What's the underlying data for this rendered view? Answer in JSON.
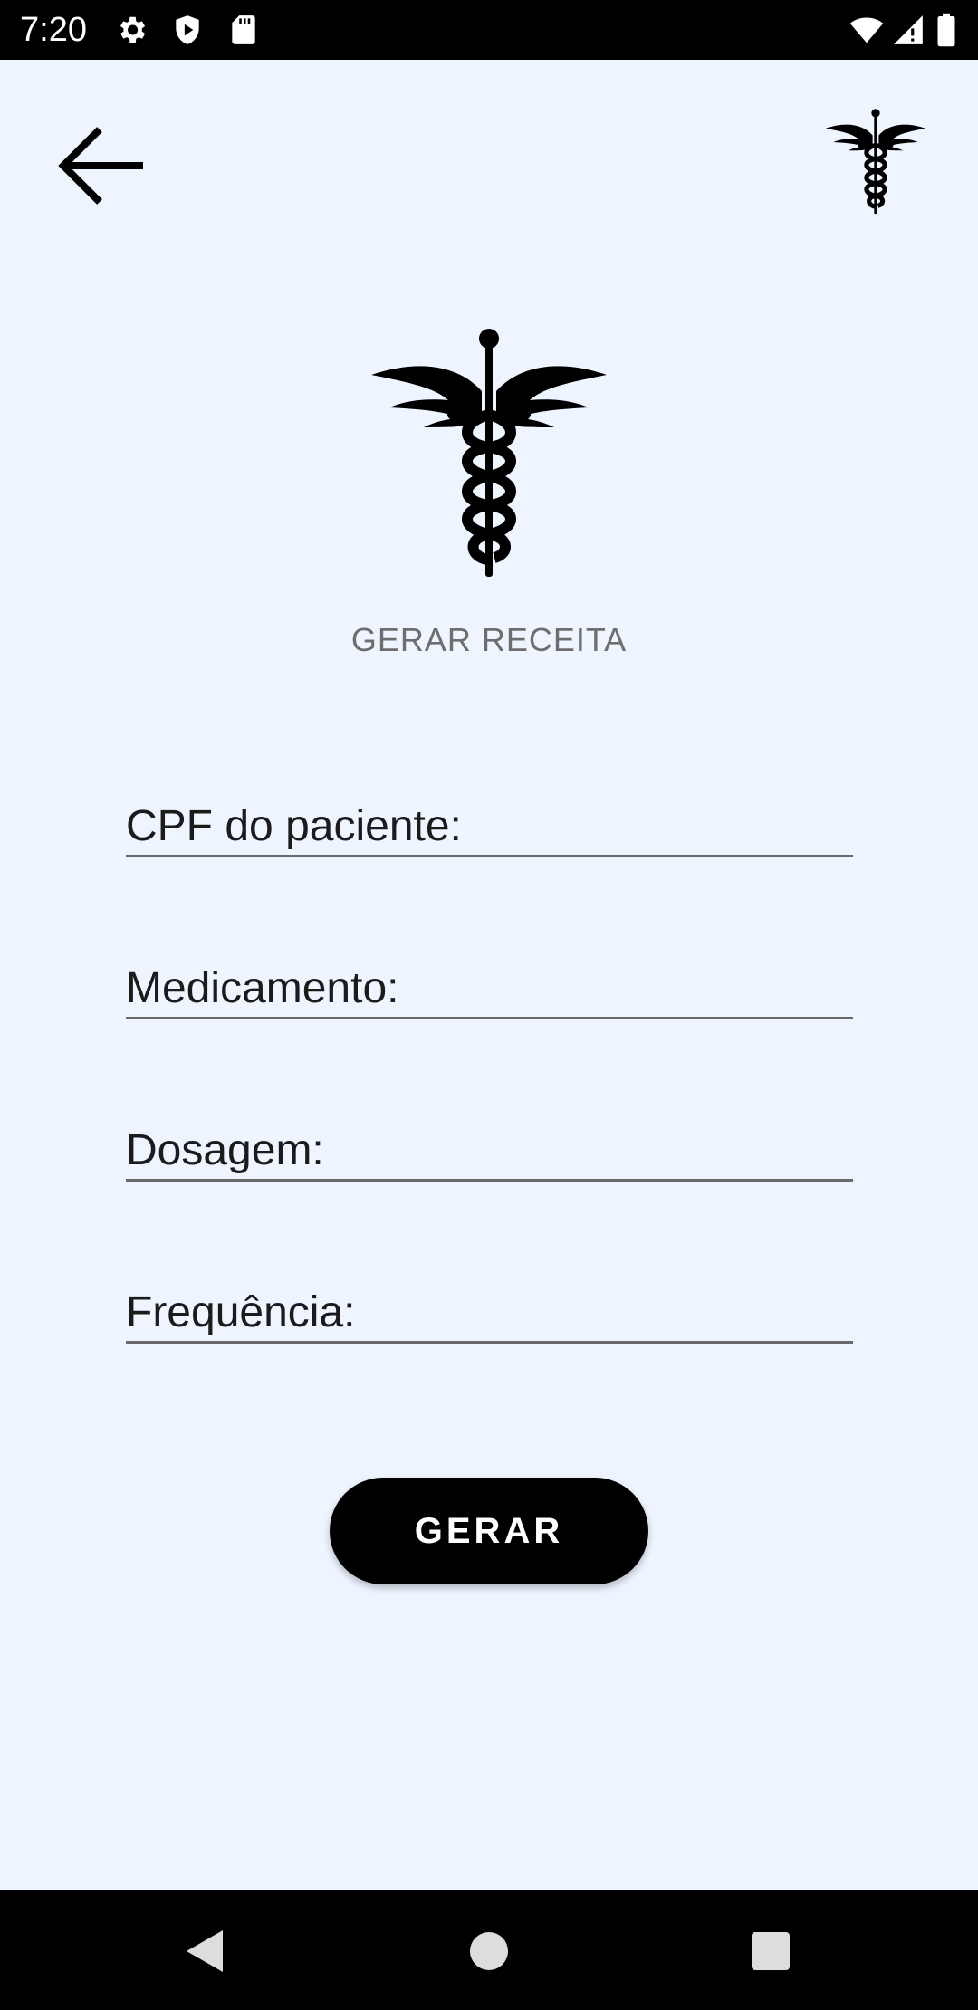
{
  "status_bar": {
    "time": "7:20",
    "icons": [
      "settings-icon",
      "shield-icon",
      "sd-card-icon",
      "wifi-icon",
      "signal-icon",
      "battery-icon"
    ]
  },
  "header": {
    "back_icon": "arrow-left-icon",
    "logo_icon": "caduceus-icon"
  },
  "main": {
    "logo_icon": "caduceus-icon",
    "title": "GERAR RECEITA",
    "fields": [
      {
        "placeholder": "CPF do paciente:",
        "value": ""
      },
      {
        "placeholder": "Medicamento:",
        "value": ""
      },
      {
        "placeholder": "Dosagem:",
        "value": ""
      },
      {
        "placeholder": "Frequência:",
        "value": ""
      }
    ],
    "submit_label": "GERAR"
  },
  "nav_bar": {
    "buttons": [
      "back-triangle-icon",
      "home-circle-icon",
      "recents-square-icon"
    ]
  },
  "colors": {
    "background": "#eef5ff",
    "accent": "#000000",
    "title_text": "#6e6e6e",
    "underline": "#6a6a6a"
  }
}
